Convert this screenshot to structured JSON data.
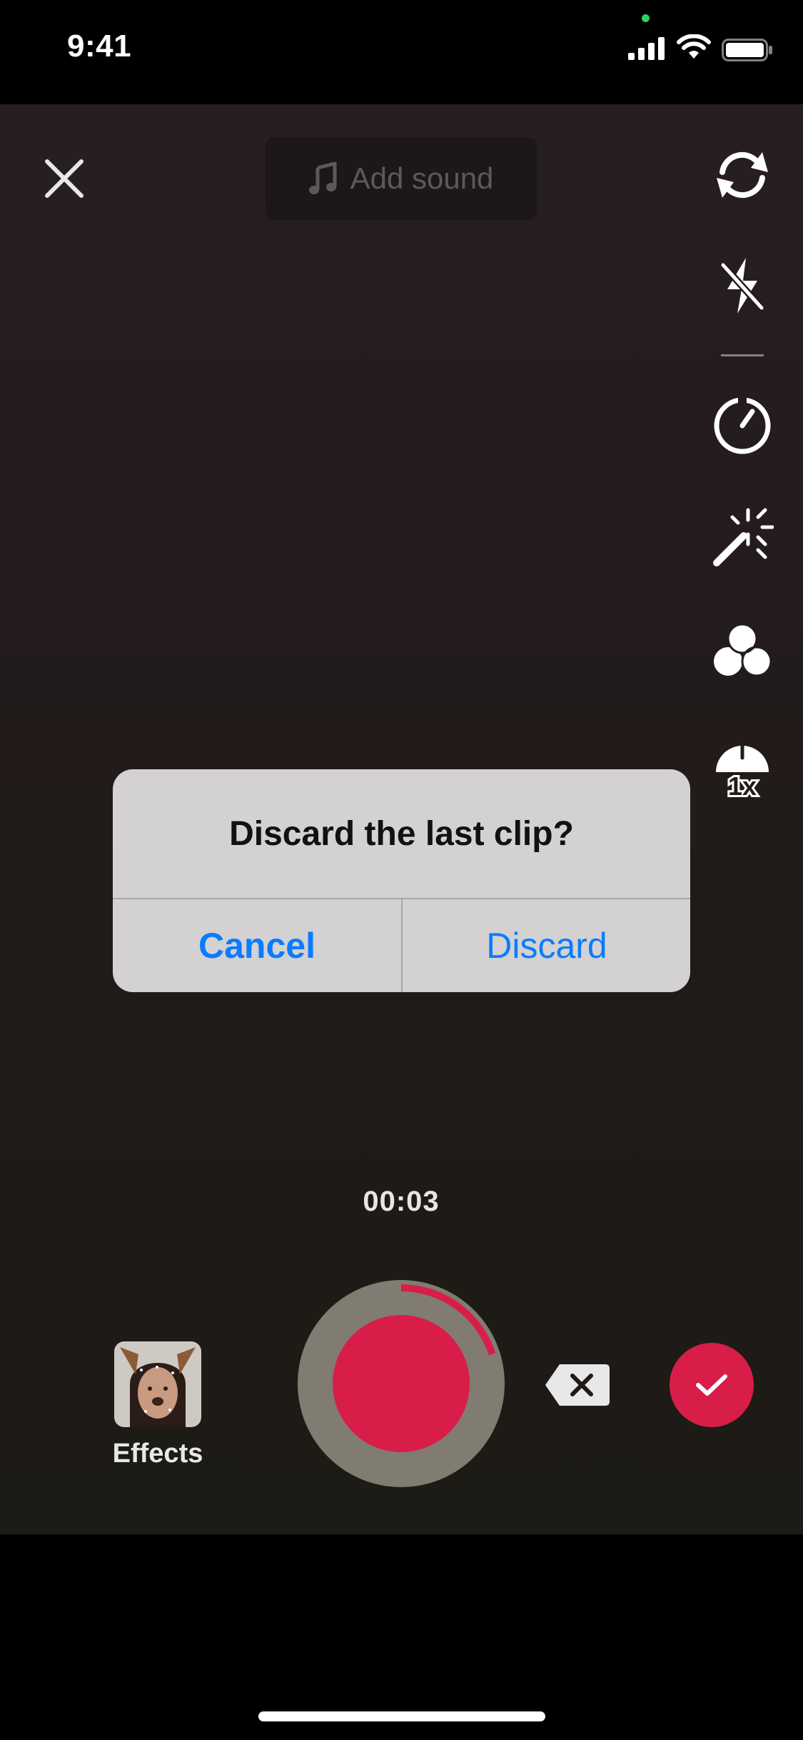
{
  "status_bar": {
    "time": "9:41"
  },
  "top_bar": {
    "add_sound_label": "Add sound"
  },
  "side_toolbar": {
    "icons": [
      "flip-camera-icon",
      "flash-off-icon",
      "timer-icon",
      "beauty-wand-icon",
      "filters-icon",
      "speed-icon"
    ],
    "speed_label": "1x"
  },
  "alert": {
    "title": "Discard the last clip?",
    "cancel_label": "Cancel",
    "discard_label": "Discard"
  },
  "recording": {
    "timer": "00:03",
    "progress_fraction": 0.2
  },
  "effects": {
    "label": "Effects"
  },
  "colors": {
    "accent_red": "#d81e48",
    "alert_button_blue": "#0a7cff",
    "alert_background": "#d3d1d1"
  }
}
